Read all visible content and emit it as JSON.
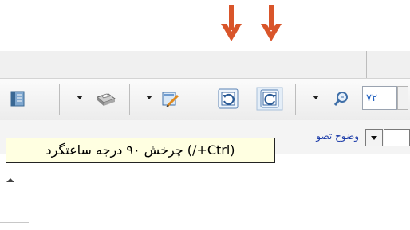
{
  "tooltip": {
    "text": "چرخش ۹۰ درجه ساعتگرد (/+Ctrl)"
  },
  "toolbar": {
    "zoom_value": "۷۲"
  },
  "row2": {
    "label": "وضوح تصو"
  },
  "colors": {
    "arrow": "#d9552a",
    "tooltip_bg": "#ffffe1",
    "label_blue": "#1a3aa8"
  },
  "icons": [
    "down-arrow-icon",
    "down-arrow-icon",
    "panel-icon",
    "printer-icon",
    "edit-page-icon",
    "rotate-ccw-icon",
    "rotate-cw-icon",
    "zoom-icon"
  ]
}
